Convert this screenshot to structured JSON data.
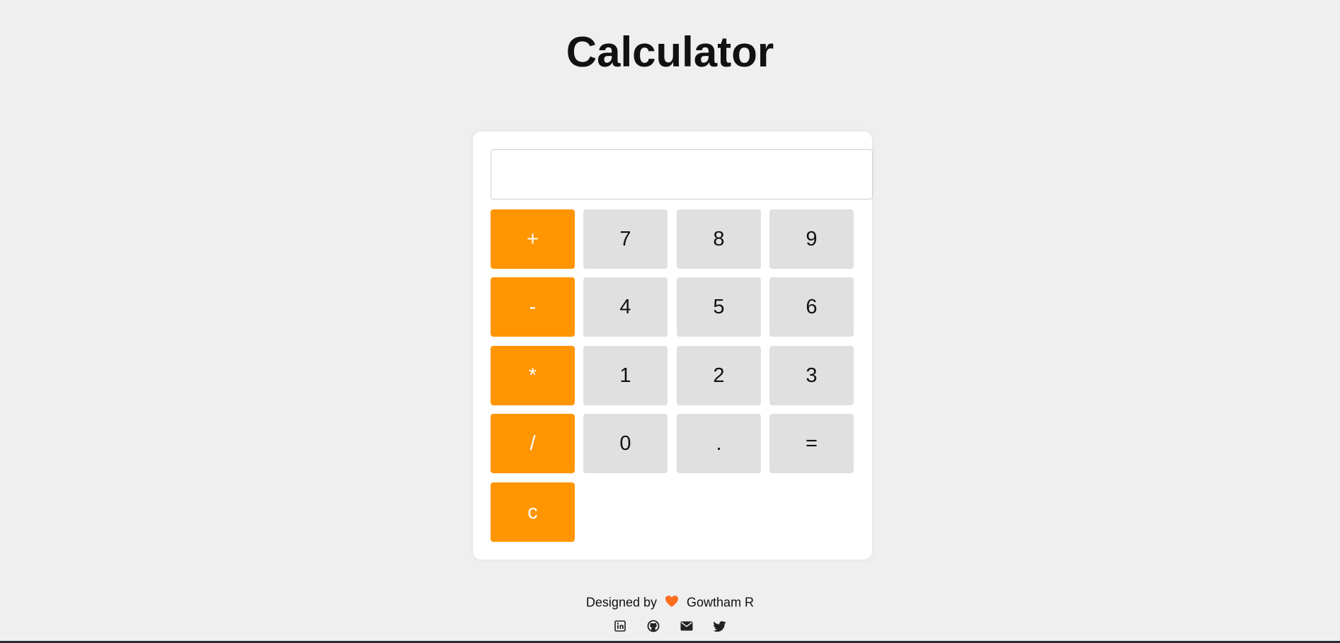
{
  "page": {
    "title": "Calculator"
  },
  "display": {
    "value": "",
    "placeholder": ""
  },
  "keys": {
    "plus": "+",
    "seven": "7",
    "eight": "8",
    "nine": "9",
    "minus": "-",
    "four": "4",
    "five": "5",
    "six": "6",
    "multiply": "*",
    "one": "1",
    "two": "2",
    "three": "3",
    "divide": "/",
    "zero": "0",
    "dot": ".",
    "equals": "=",
    "clear": "c"
  },
  "footer": {
    "designed_by": "Designed by",
    "author": "Gowtham R",
    "heart_icon": "orange-heart-icon",
    "social_icons": [
      "linkedin-icon",
      "github-icon",
      "email-icon",
      "twitter-icon"
    ]
  },
  "colors": {
    "operator_key": "#ff9500",
    "number_key": "#e0e0e0",
    "background": "#efefef",
    "heart": "#ff6d1f"
  }
}
